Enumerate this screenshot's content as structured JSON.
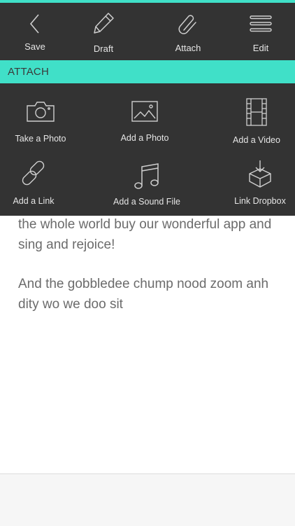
{
  "toolbar": {
    "save": {
      "label": "Save",
      "icon": "chevron-left-icon"
    },
    "draft": {
      "label": "Draft",
      "icon": "pencil-icon"
    },
    "attach": {
      "label": "Attach",
      "icon": "paperclip-icon"
    },
    "edit": {
      "label": "Edit",
      "icon": "menu-icon"
    }
  },
  "attach_panel": {
    "title": "ATTACH",
    "items": [
      {
        "label": "Take a Photo",
        "icon": "camera-icon"
      },
      {
        "label": "Add a Photo",
        "icon": "image-icon"
      },
      {
        "label": "Add a Video",
        "icon": "film-icon"
      },
      {
        "label": "Add a Link",
        "icon": "link-icon"
      },
      {
        "label": "Add a Sound File",
        "icon": "music-note-icon"
      },
      {
        "label": "Link Dropbox",
        "icon": "dropbox-icon"
      }
    ]
  },
  "content": {
    "paragraphs": [
      "the whole world buy our wonderful app and sing and rejoice!",
      "And the gobbledee chump nood zoom anh dity wo we doo sit"
    ]
  },
  "colors": {
    "accent": "#40e0c8",
    "dark": "#333333",
    "text": "#6b6b6b"
  }
}
